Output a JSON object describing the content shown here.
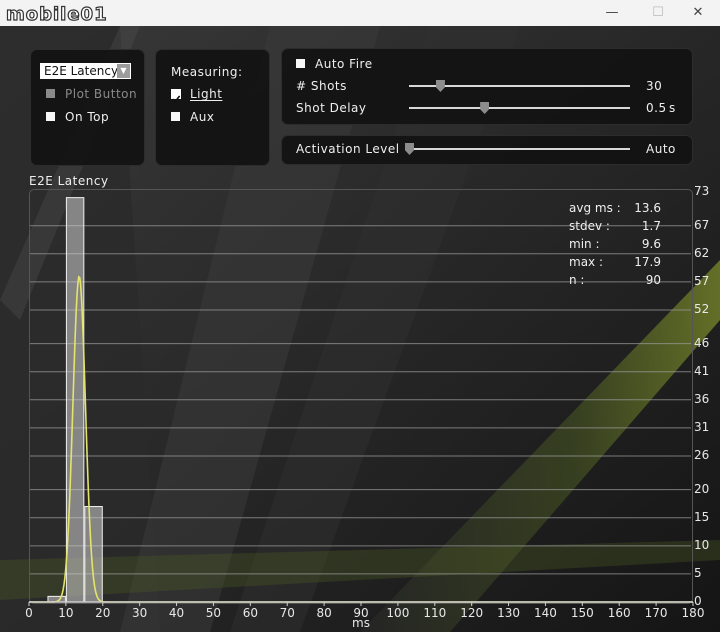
{
  "window": {
    "logo_text": "mobile01",
    "controls": {
      "minimize": "—",
      "maximize": "☐",
      "close": "✕"
    }
  },
  "left_panel": {
    "mode_select": {
      "value": "E2E Latency"
    },
    "plot_button": {
      "label": "Plot Button",
      "checked": false,
      "enabled": false
    },
    "on_top": {
      "label": "On Top",
      "checked": false
    }
  },
  "measuring_panel": {
    "title": "Measuring:",
    "light": {
      "label": "Light",
      "checked": true
    },
    "aux": {
      "label": "Aux",
      "checked": false
    }
  },
  "fire_panel": {
    "auto_fire": {
      "label": "Auto Fire",
      "checked": false
    },
    "shots": {
      "label": "# Shots",
      "value": "30",
      "fraction": 0.14
    },
    "shot_delay": {
      "label": "Shot Delay",
      "value": "0.5",
      "unit": "s",
      "fraction": 0.34
    }
  },
  "activation_panel": {
    "label": "Activation Level",
    "value": "Auto",
    "fraction": 0.0
  },
  "plot": {
    "title": "E2E Latency",
    "stats": [
      {
        "label": "avg ms :",
        "value": "13.6"
      },
      {
        "label": "stdev :",
        "value": "1.7"
      },
      {
        "label": "min :",
        "value": "9.6"
      },
      {
        "label": "max :",
        "value": "17.9"
      },
      {
        "label": "n :",
        "value": "90"
      }
    ]
  },
  "chart_data": {
    "type": "bar",
    "title": "E2E Latency",
    "xlabel": "ms",
    "ylabel": "",
    "xlim": [
      0,
      180
    ],
    "ylim": [
      0,
      73
    ],
    "x_ticks": [
      "0",
      "10",
      "20",
      "30",
      "40",
      "50",
      "60",
      "70",
      "80",
      "90",
      "100",
      "110",
      "120",
      "130",
      "140",
      "150",
      "160",
      "170",
      "180"
    ],
    "y_ticks": [
      "73",
      "67",
      "62",
      "57",
      "52",
      "46",
      "41",
      "36",
      "31",
      "26",
      "20",
      "15",
      "10",
      "5",
      "0"
    ],
    "grid": true,
    "bins": [
      {
        "x0": 5,
        "x1": 10,
        "count": 1
      },
      {
        "x0": 10,
        "x1": 15,
        "count": 72
      },
      {
        "x0": 15,
        "x1": 20,
        "count": 17
      }
    ],
    "fit_curve": {
      "type": "normal",
      "mean": 13.6,
      "stdev": 1.7,
      "peak": 58,
      "color": "#e4e36a"
    },
    "bar_color": "#d0d0d0"
  }
}
